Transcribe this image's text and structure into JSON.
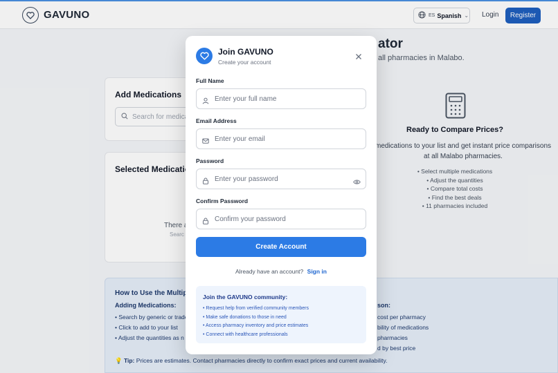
{
  "header": {
    "brand": "GAVUNO",
    "language": {
      "flag": "ES",
      "label": "Spanish"
    },
    "login_label": "Login",
    "register_label": "Register"
  },
  "page": {
    "heading_fragment": "ator",
    "subtitle_fragment": "all pharmacies in Malabo."
  },
  "add_medications": {
    "title": "Add Medications",
    "search_placeholder": "Search for medica"
  },
  "selected_medications": {
    "title": "Selected Medication",
    "empty_text": "There a",
    "empty_sub": "Searc"
  },
  "compare": {
    "title": "Ready to Compare Prices?",
    "description": "medications to your list and get instant price comparisons at all Malabo pharmacies.",
    "bullets": [
      "• Select multiple medications",
      "• Adjust the quantities",
      "• Compare total costs",
      "• Find the best deals",
      "• 11 pharmacies included"
    ]
  },
  "howto": {
    "title": "How to Use the Multiple",
    "left_subtitle": "Adding Medications:",
    "left_items": [
      "• Search by generic or trade",
      "• Click to add to your list",
      "• Adjust the quantities as n"
    ],
    "right_subtitle": "son:",
    "right_items": [
      "cost per pharmacy",
      "bility of medications",
      "pharmacies",
      "d by best price"
    ],
    "tip_label": "Tip:",
    "tip_text": "Prices are estimates. Contact pharmacies directly to confirm exact prices and current availability."
  },
  "modal": {
    "title": "Join GAVUNO",
    "subtitle": "Create your account",
    "fields": {
      "full_name": {
        "label": "Full Name",
        "placeholder": "Enter your full name"
      },
      "email": {
        "label": "Email Address",
        "placeholder": "Enter your email"
      },
      "password": {
        "label": "Password",
        "placeholder": "Enter your password"
      },
      "confirm_password": {
        "label": "Confirm Password",
        "placeholder": "Confirm your password"
      }
    },
    "submit_label": "Create Account",
    "have_account_text": "Already have an account?",
    "sign_in_label": "Sign in",
    "community": {
      "title": "Join the GAVUNO community:",
      "items": [
        "• Request help from verified community members",
        "• Make safe donations to those in need",
        "• Access pharmacy inventory and price estimates",
        "• Connect with healthcare professionals"
      ]
    }
  },
  "colors": {
    "primary": "#2c7be5",
    "register": "#1e5fbf",
    "info_bg": "#e6eef9"
  }
}
